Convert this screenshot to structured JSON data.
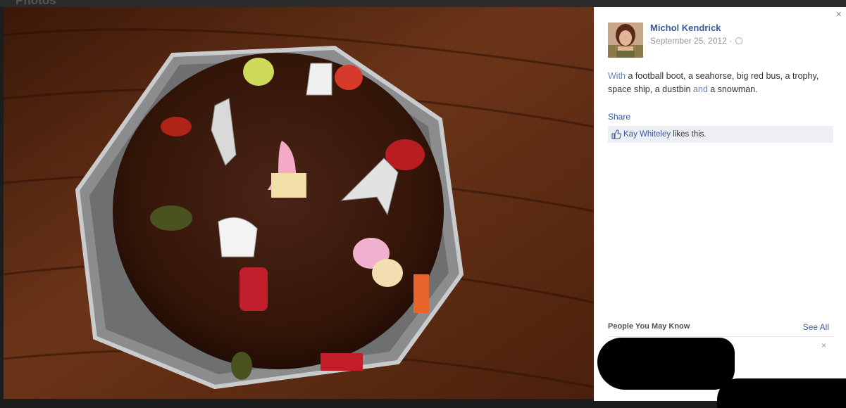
{
  "header": {
    "title": "Photos"
  },
  "photo": {
    "description": "Chocolate cake on a metal tray on a wooden table, topped with jelly sweets"
  },
  "sidebar": {
    "close_glyph": "×",
    "author_name": "Michol Kendrick",
    "post_date": "September 25, 2012",
    "date_separator": "·",
    "caption": {
      "part1": "With",
      "part2": " a football boot, a seahorse, big red bus, a trophy, space ship, a dustbin ",
      "part3": "and",
      "part4": " a snowman."
    },
    "share_label": "Share",
    "likes": {
      "liker": "Kay Whiteley",
      "suffix": " likes this."
    },
    "pymk": {
      "title": "People You May Know",
      "see_all": "See All",
      "dismiss_glyph": "×"
    }
  },
  "colors": {
    "link": "#3b5998",
    "likes_bg": "#edeff4",
    "panel_bg": "#ffffff",
    "backdrop": "#1d1d1d"
  },
  "icons": [
    "globe-icon",
    "like-thumb-icon",
    "close-icon"
  ]
}
